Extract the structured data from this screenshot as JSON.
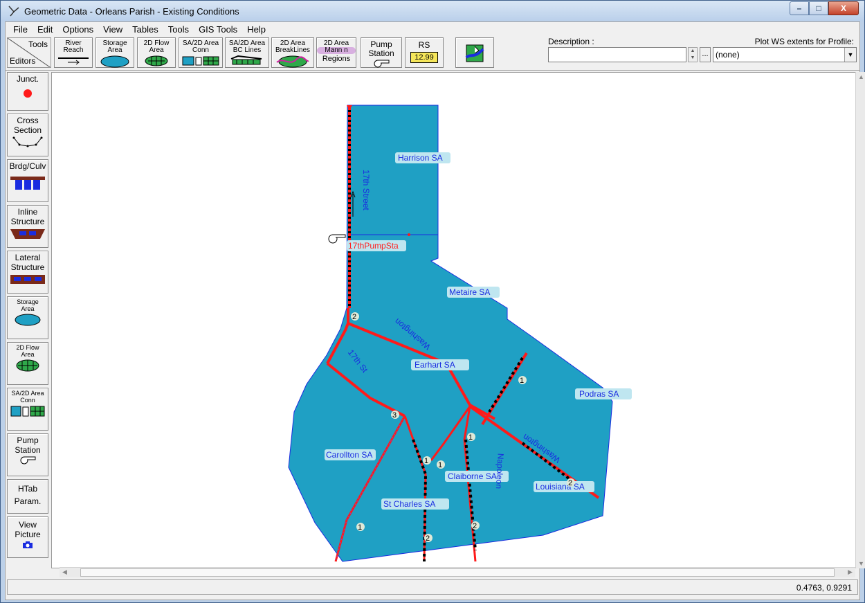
{
  "window": {
    "title": "Geometric Data - Orleans Parish - Existing Conditions",
    "controls": {
      "minimize": "–",
      "maximize": "□",
      "close": "X"
    }
  },
  "menu": {
    "items": [
      {
        "label": "File"
      },
      {
        "label": "Edit"
      },
      {
        "label": "Options"
      },
      {
        "label": "View"
      },
      {
        "label": "Tables"
      },
      {
        "label": "Tools"
      },
      {
        "label": "GIS Tools"
      },
      {
        "label": "Help"
      }
    ]
  },
  "toolbar": {
    "corner_top": "Tools",
    "corner_bottom": "Editors",
    "buttons": [
      {
        "line1": "River",
        "line2": "Reach",
        "icon": "river-reach-icon"
      },
      {
        "line1": "Storage",
        "line2": "Area",
        "icon": "storage-area-icon"
      },
      {
        "line1": "2D Flow",
        "line2": "Area",
        "icon": "2d-flow-area-icon"
      },
      {
        "line1": "SA/2D Area",
        "line2": "Conn",
        "icon": "sa-2d-conn-icon"
      },
      {
        "line1": "SA/2D Area",
        "line2": "BC Lines",
        "icon": "bc-lines-icon"
      },
      {
        "line1": "2D Area",
        "line2": "BreakLines",
        "icon": "breaklines-icon"
      },
      {
        "line1": "2D Area",
        "line2": "Mann n",
        "line3": "Regions",
        "icon": "mann-regions-icon"
      },
      {
        "line1": "Pump",
        "line2": "Station",
        "icon": "pump-station-icon"
      },
      {
        "line1": "RS",
        "line2": "12.99",
        "icon": "river-station-icon"
      },
      {
        "line1": "",
        "line2": "",
        "icon": "background-map-icon"
      }
    ],
    "description_label": "Description :",
    "description_value": "",
    "ellipsis": "...",
    "plot_label": "Plot WS extents for Profile:",
    "plot_value": "(none)"
  },
  "editors": [
    {
      "label": "Junct.",
      "icon": "junction-icon"
    },
    {
      "label": "Cross",
      "label2": "Section",
      "icon": "cross-section-icon"
    },
    {
      "label": "Brdg/Culv",
      "icon": "bridge-culvert-icon"
    },
    {
      "label": "Inline",
      "label2": "Structure",
      "icon": "inline-structure-icon"
    },
    {
      "label": "Lateral",
      "label2": "Structure",
      "icon": "lateral-structure-icon"
    },
    {
      "label": "Storage",
      "label2": "Area",
      "icon": "storage-area-icon"
    },
    {
      "label": "2D Flow",
      "label2": "Area",
      "icon": "2d-flow-area-icon"
    },
    {
      "label": "SA/2D Area",
      "label2": "Conn",
      "icon": "sa-2d-conn-icon"
    },
    {
      "label": "Pump",
      "label2": "Station",
      "icon": "pump-station-icon"
    },
    {
      "label": "HTab",
      "label2": "Param.",
      "icon": ""
    },
    {
      "label": "View",
      "label2": "Picture",
      "icon": "camera-icon"
    }
  ],
  "map": {
    "colors": {
      "area_fill": "#1fa0c4",
      "area_outline": "#1a2ce0",
      "conn": "#ff1a1a",
      "label_bg": "#bfe6f0",
      "label_text": "#1a2ce0"
    },
    "storage_areas": [
      "Harrison SA",
      "Metaire SA",
      "Earhart SA",
      "Podras SA",
      "Carollton SA",
      "Claiborne SA",
      "Louisiana SA",
      "St Charles SA"
    ],
    "pump_station": "17thPumpSta",
    "street_labels": {
      "seventeenth_street": "17th Street",
      "seventeenth_st": "17th St",
      "washington": "Washington",
      "washington2": "Washington",
      "napoleon": "Napoleon"
    },
    "reach_numbers": [
      "2",
      "1",
      "3",
      "1",
      "1",
      "1",
      "2",
      "1",
      "2",
      "2"
    ]
  },
  "status": {
    "coords": "0.4763, 0.9291"
  }
}
